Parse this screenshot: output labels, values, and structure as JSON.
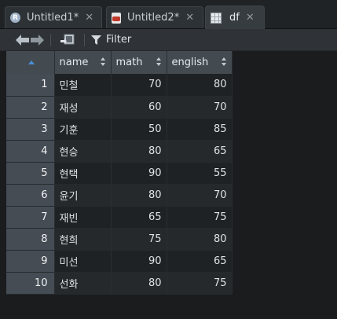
{
  "tabs": [
    {
      "label": "Untitled1*",
      "icon": "r-script-icon",
      "active": false
    },
    {
      "label": "Untitled2*",
      "icon": "rmarkdown-icon",
      "active": false
    },
    {
      "label": "df",
      "icon": "data-grid-icon",
      "active": true
    }
  ],
  "toolbar": {
    "filter_label": "Filter"
  },
  "table": {
    "columns": [
      "name",
      "math",
      "english"
    ],
    "rows": [
      {
        "index": "1",
        "name": "민철",
        "math": "70",
        "english": "80"
      },
      {
        "index": "2",
        "name": "재성",
        "math": "60",
        "english": "70"
      },
      {
        "index": "3",
        "name": "기훈",
        "math": "50",
        "english": "85"
      },
      {
        "index": "4",
        "name": "현승",
        "math": "80",
        "english": "65"
      },
      {
        "index": "5",
        "name": "현택",
        "math": "90",
        "english": "55"
      },
      {
        "index": "6",
        "name": "윤기",
        "math": "80",
        "english": "70"
      },
      {
        "index": "7",
        "name": "재빈",
        "math": "65",
        "english": "75"
      },
      {
        "index": "8",
        "name": "현희",
        "math": "75",
        "english": "80"
      },
      {
        "index": "9",
        "name": "미선",
        "math": "90",
        "english": "65"
      },
      {
        "index": "10",
        "name": "선화",
        "math": "80",
        "english": "75"
      }
    ]
  }
}
